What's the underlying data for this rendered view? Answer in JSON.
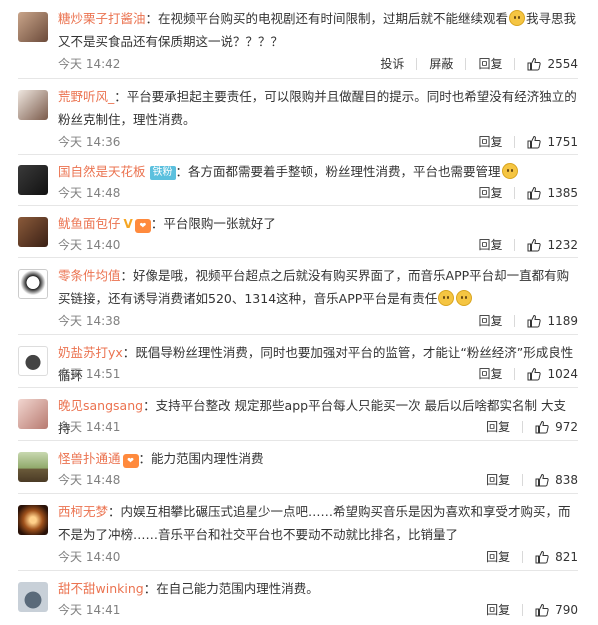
{
  "comments": [
    {
      "user": "糖炒栗子打酱油",
      "text": "在视频平台购买的电视剧还有时间限制，过期后就不能继续观看",
      "text2": "我寻思我又不是买食品还有保质期这一说？？？？",
      "time": "今天 14:42",
      "report": "投诉",
      "block": "屏蔽",
      "reply": "回复",
      "likes": "2554"
    },
    {
      "user": "荒野听风_",
      "text": "平台要承担起主要责任，可以限购并且做醒目的提示。同时也希望没有经济独立的粉丝克制住，理性消费。",
      "time": "今天 14:36",
      "reply": "回复",
      "likes": "1751"
    },
    {
      "user": "国自然是天花板",
      "badge": "铁粉",
      "text": "各方面都需要着手整顿，粉丝理性消费，平台也需要管理",
      "time": "今天 14:48",
      "reply": "回复",
      "likes": "1385"
    },
    {
      "user": "鱿鱼面包仔",
      "text": "平台限购一张就好了",
      "time": "今天 14:40",
      "reply": "回复",
      "likes": "1232"
    },
    {
      "user": "零条件均值",
      "text": "好像是哦，视频平台超点之后就没有购买界面了，而音乐APP平台却一直都有购买链接，还有诱导消费诸如520、1314这种，音乐APP平台是有责任",
      "time": "今天 14:38",
      "reply": "回复",
      "likes": "1189"
    },
    {
      "user": "奶盐苏打yx",
      "text": "既倡导粉丝理性消费，同时也要加强对平台的监管，才能让“粉丝经济”形成良性循环",
      "time": "今天 14:51",
      "reply": "回复",
      "likes": "1024"
    },
    {
      "user": "晚见sangsang",
      "text": "支持平台整改 规定那些app平台每人只能买一次 最后以后啥都实名制 大支持",
      "time": "今天 14:41",
      "reply": "回复",
      "likes": "972"
    },
    {
      "user": "怪兽扑通通",
      "text": "能力范围内理性消费",
      "time": "今天 14:48",
      "reply": "回复",
      "likes": "838"
    },
    {
      "user": "西柯无梦",
      "text": "内娱互相攀比碾压式追星少一点吧……希望购买音乐是因为喜欢和享受才购买，而不是为了冲榜……音乐平台和社交平台也不要动不动就比排名，比销量了",
      "time": "今天 14:40",
      "reply": "回复",
      "likes": "821"
    },
    {
      "user": "甜不甜winking",
      "text": "在自己能力范围内理性消费。",
      "time": "今天 14:41",
      "reply": "回复",
      "likes": "790"
    }
  ],
  "colors": {
    "username": "#eb7350",
    "meta": "#808080",
    "divider": "#e6e6e6"
  }
}
